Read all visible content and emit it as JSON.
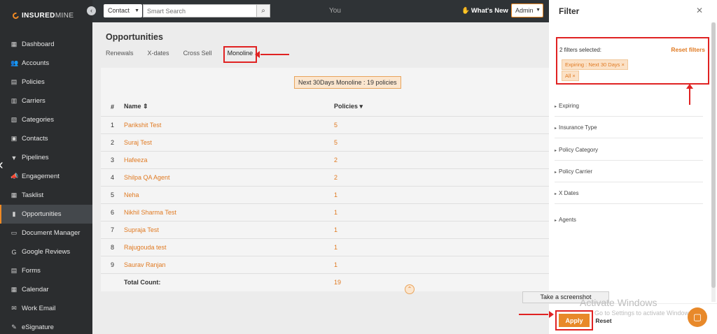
{
  "sidebar": {
    "logo": {
      "brand": "INSURED",
      "suffix": "MINE"
    },
    "items": [
      {
        "label": "Dashboard",
        "icon": "dashboard-icon",
        "glyph": "▦"
      },
      {
        "label": "Accounts",
        "icon": "users-icon",
        "glyph": "👥"
      },
      {
        "label": "Policies",
        "icon": "file-icon",
        "glyph": "▤"
      },
      {
        "label": "Carriers",
        "icon": "carrier-icon",
        "glyph": "▥"
      },
      {
        "label": "Categories",
        "icon": "categories-icon",
        "glyph": "▧"
      },
      {
        "label": "Contacts",
        "icon": "contacts-icon",
        "glyph": "▣"
      },
      {
        "label": "Pipelines",
        "icon": "filter-icon",
        "glyph": "▼"
      },
      {
        "label": "Engagement",
        "icon": "megaphone-icon",
        "glyph": "📣"
      },
      {
        "label": "Tasklist",
        "icon": "tasklist-icon",
        "glyph": "▦"
      },
      {
        "label": "Opportunities",
        "icon": "chart-icon",
        "glyph": "▮"
      },
      {
        "label": "Document Manager",
        "icon": "folder-icon",
        "glyph": "▭"
      },
      {
        "label": "Google Reviews",
        "icon": "google-icon",
        "glyph": "G"
      },
      {
        "label": "Forms",
        "icon": "form-icon",
        "glyph": "▤"
      },
      {
        "label": "Calendar",
        "icon": "calendar-icon",
        "glyph": "▦"
      },
      {
        "label": "Work Email",
        "icon": "mail-icon",
        "glyph": "✉"
      },
      {
        "label": "eSignature",
        "icon": "signature-icon",
        "glyph": "✎"
      }
    ],
    "active": "Opportunities"
  },
  "topbar": {
    "contact_select": "Contact",
    "search_placeholder": "Smart Search",
    "you": "You",
    "whats_new": "What's New",
    "admin": "Admin"
  },
  "main": {
    "title": "Opportunities",
    "tabs": [
      "Renewals",
      "X-dates",
      "Cross Sell",
      "Monoline"
    ],
    "active_tab": "Monoline",
    "summary": "Next 30Days  Monoline : 19 policies",
    "columns": [
      "#",
      "Name ⇕",
      "Policies ▾"
    ],
    "rows": [
      {
        "n": "1",
        "name": "Parikshit Test",
        "policies": "5"
      },
      {
        "n": "2",
        "name": "Suraj Test",
        "policies": "5"
      },
      {
        "n": "3",
        "name": "Hafeeza",
        "policies": "2"
      },
      {
        "n": "4",
        "name": "Shilpa QA Agent",
        "policies": "2"
      },
      {
        "n": "5",
        "name": "Neha",
        "policies": "1"
      },
      {
        "n": "6",
        "name": "Nikhil Sharma Test",
        "policies": "1"
      },
      {
        "n": "7",
        "name": "Supraja Test",
        "policies": "1"
      },
      {
        "n": "8",
        "name": "Rajugouda test",
        "policies": "1"
      },
      {
        "n": "9",
        "name": "Saurav Ranjan",
        "policies": "1"
      }
    ],
    "total_label": "Total Count:",
    "total_value": "19"
  },
  "filter": {
    "title": "Filter",
    "selected_text": "2 filters selected:",
    "reset_filters": "Reset filters",
    "chips": [
      "Expiring : Next 30 Days ×",
      "All ×"
    ],
    "groups": [
      "Expiring",
      "Insurance Type",
      "Policy Category",
      "Policy Carrier",
      "X Dates",
      "Agents"
    ],
    "apply": "Apply",
    "reset": "Reset"
  },
  "overlay": {
    "screenshot_tip": "Take a screenshot",
    "activate_title": "Activate Windows",
    "activate_sub": "Go to Settings to activate Windows."
  },
  "colors": {
    "accent": "#e8892a",
    "sidebar": "#2b2d2f",
    "annotation": "#e02222"
  }
}
